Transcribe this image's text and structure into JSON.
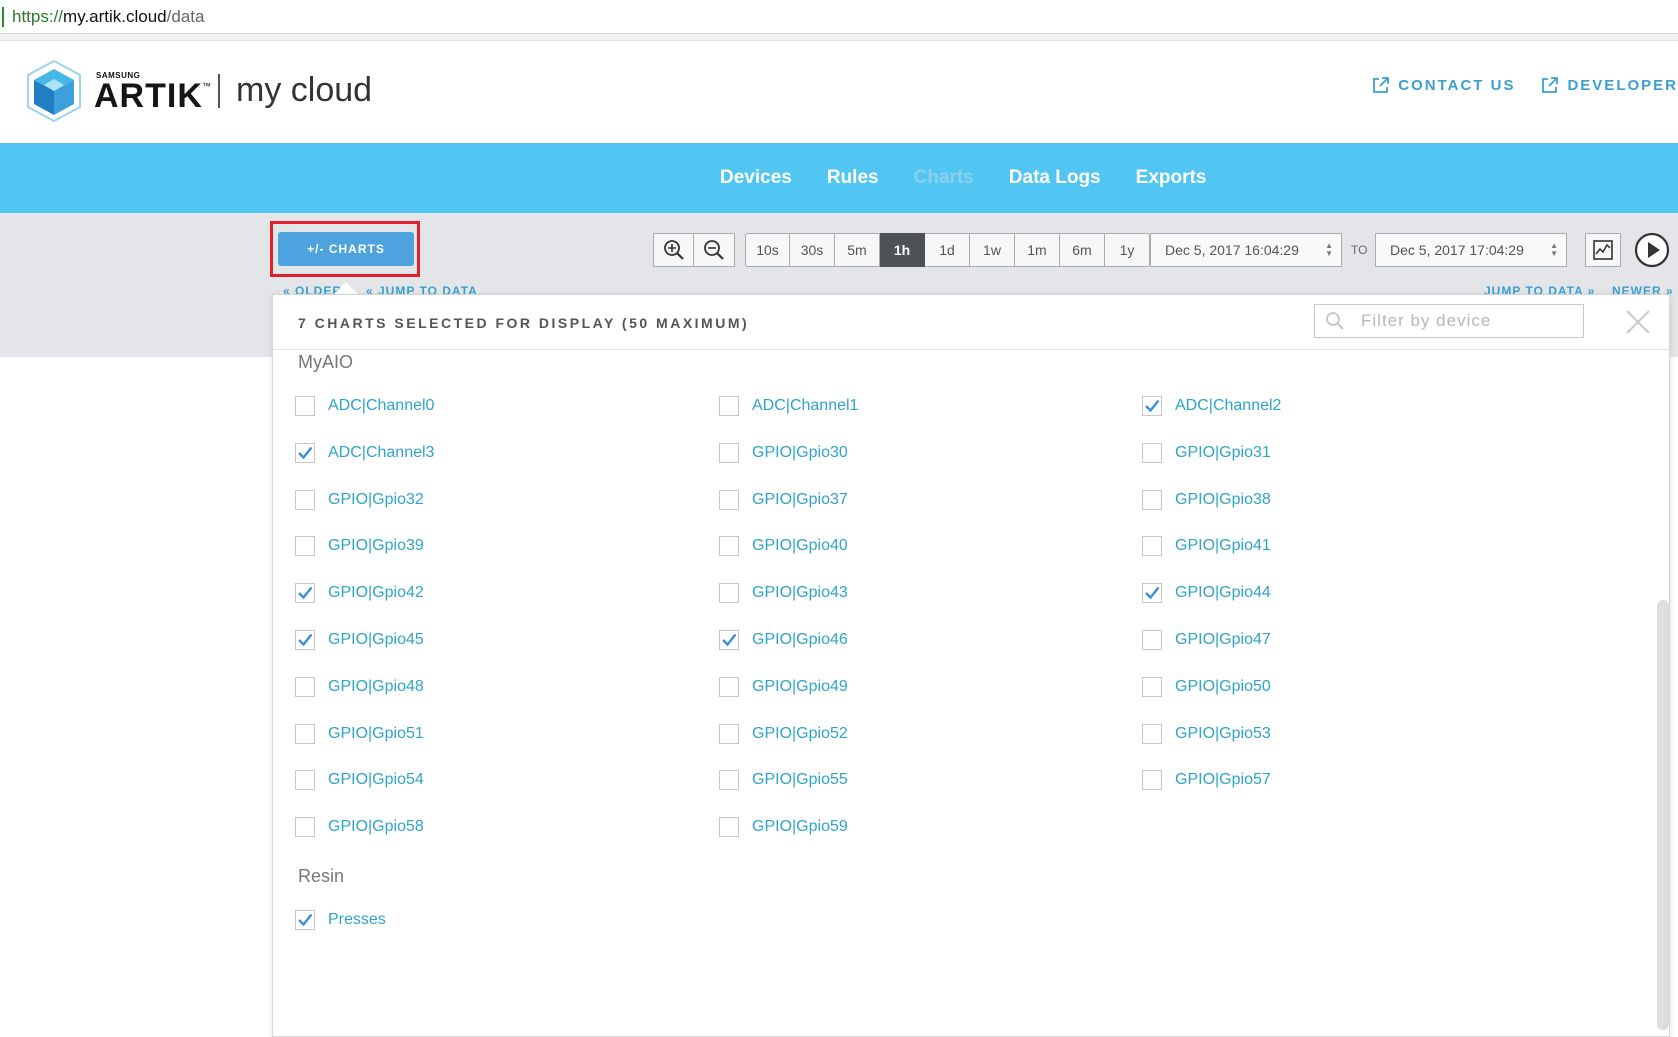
{
  "browser": {
    "url_scheme": "https://",
    "url_host": "my.artik.cloud",
    "url_path": "/data"
  },
  "header": {
    "brand_small": "SAMSUNG",
    "brand": "ARTIK",
    "brand_tm": "™",
    "product": "my cloud",
    "links": [
      {
        "label": "CONTACT US",
        "icon": "external-link-icon"
      },
      {
        "label": "DEVELOPER",
        "icon": "external-link-icon"
      }
    ]
  },
  "nav": {
    "items": [
      "Devices",
      "Rules",
      "Charts",
      "Data Logs",
      "Exports"
    ],
    "active": "Charts"
  },
  "toolbar": {
    "charts_button": "+/- CHARTS",
    "ranges": [
      "10s",
      "30s",
      "5m",
      "1h",
      "1d",
      "1w",
      "1m",
      "6m",
      "1y"
    ],
    "selected_range": "1h",
    "date_from": "Dec 5, 2017 16:04:29",
    "to_label": "TO",
    "date_to": "Dec 5, 2017 17:04:29",
    "older": "« OLDER",
    "jump_left": "« JUMP TO DATA",
    "jump_right": "JUMP TO DATA »",
    "newer": "NEWER »"
  },
  "panel": {
    "title": "7 CHARTS SELECTED FOR DISPLAY (50 MAXIMUM)",
    "filter_placeholder": "Filter by device",
    "groups": [
      {
        "name": "MyAIO",
        "items": [
          {
            "label": "ADC|Channel0",
            "checked": false
          },
          {
            "label": "ADC|Channel1",
            "checked": false
          },
          {
            "label": "ADC|Channel2",
            "checked": true
          },
          {
            "label": "ADC|Channel3",
            "checked": true
          },
          {
            "label": "GPIO|Gpio30",
            "checked": false
          },
          {
            "label": "GPIO|Gpio31",
            "checked": false
          },
          {
            "label": "GPIO|Gpio32",
            "checked": false
          },
          {
            "label": "GPIO|Gpio37",
            "checked": false
          },
          {
            "label": "GPIO|Gpio38",
            "checked": false
          },
          {
            "label": "GPIO|Gpio39",
            "checked": false
          },
          {
            "label": "GPIO|Gpio40",
            "checked": false
          },
          {
            "label": "GPIO|Gpio41",
            "checked": false
          },
          {
            "label": "GPIO|Gpio42",
            "checked": true
          },
          {
            "label": "GPIO|Gpio43",
            "checked": false
          },
          {
            "label": "GPIO|Gpio44",
            "checked": true
          },
          {
            "label": "GPIO|Gpio45",
            "checked": true
          },
          {
            "label": "GPIO|Gpio46",
            "checked": true
          },
          {
            "label": "GPIO|Gpio47",
            "checked": false
          },
          {
            "label": "GPIO|Gpio48",
            "checked": false
          },
          {
            "label": "GPIO|Gpio49",
            "checked": false
          },
          {
            "label": "GPIO|Gpio50",
            "checked": false
          },
          {
            "label": "GPIO|Gpio51",
            "checked": false
          },
          {
            "label": "GPIO|Gpio52",
            "checked": false
          },
          {
            "label": "GPIO|Gpio53",
            "checked": false
          },
          {
            "label": "GPIO|Gpio54",
            "checked": false
          },
          {
            "label": "GPIO|Gpio55",
            "checked": false
          },
          {
            "label": "GPIO|Gpio57",
            "checked": false
          },
          {
            "label": "GPIO|Gpio58",
            "checked": false
          },
          {
            "label": "GPIO|Gpio59",
            "checked": false
          }
        ]
      },
      {
        "name": "Resin",
        "items": [
          {
            "label": "Presses",
            "checked": true
          }
        ]
      }
    ]
  },
  "colors": {
    "nav_bg": "#52c6f2",
    "link": "#2ea4c9",
    "button": "#4da3de",
    "check": "#3b8fd9",
    "highlight_frame": "#e0202a"
  }
}
